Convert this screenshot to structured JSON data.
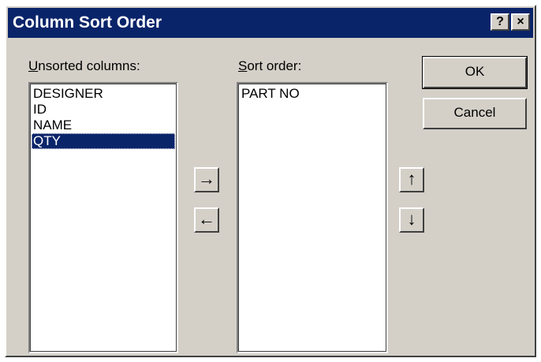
{
  "window": {
    "title": "Column Sort Order",
    "help_glyph": "?",
    "close_glyph": "×"
  },
  "unsorted": {
    "label_accel": "U",
    "label_rest": "nsorted columns:",
    "items": [
      "DESIGNER",
      "ID",
      "NAME",
      "QTY"
    ],
    "selected_index": 3
  },
  "sorted": {
    "label_accel": "S",
    "label_rest": "ort order:",
    "items": [
      "PART NO"
    ]
  },
  "buttons": {
    "ok_label": "OK",
    "cancel_label": "Cancel",
    "move_right_glyph": "→",
    "move_left_glyph": "←",
    "move_up_glyph": "↑",
    "move_down_glyph": "↓"
  },
  "colors": {
    "face": "#d4d0c8",
    "title_bar": "#0a246a",
    "selection": "#0a246a"
  }
}
